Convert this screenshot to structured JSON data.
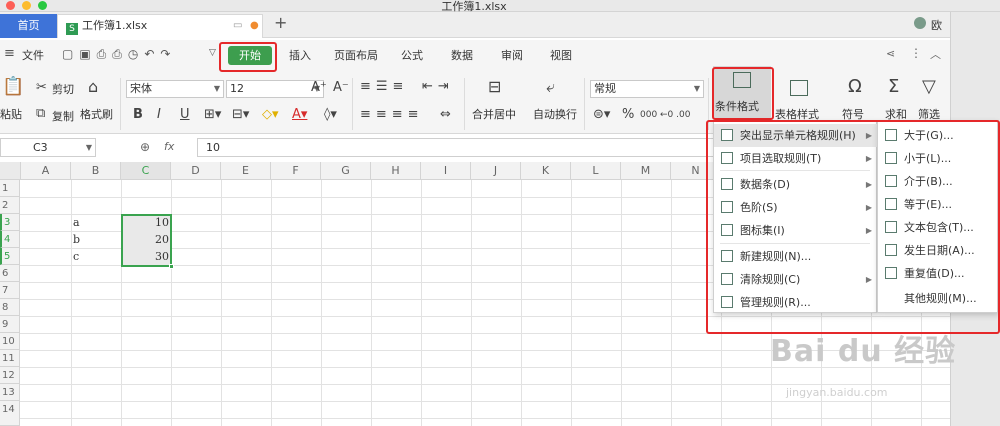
{
  "window": {
    "title": "工作簿1.xlsx"
  },
  "tabs": {
    "home": "首页",
    "file": "工作簿1.xlsx",
    "new_tab": "+",
    "user_short": "欧"
  },
  "menu": {
    "items": [
      "文件",
      "开始",
      "插入",
      "页面布局",
      "公式",
      "数据",
      "审阅",
      "视图"
    ]
  },
  "toolbar": {
    "paste": "粘贴",
    "cut": "剪切",
    "copy": "复制",
    "format_painter": "格式刷",
    "font_name": "宋体",
    "font_size": "12",
    "merge_center": "合并居中",
    "wrap_text": "自动换行",
    "number_format": "常规",
    "conditional_format": "条件格式",
    "table_style": "表格样式",
    "symbol": "符号",
    "sum": "求和",
    "filter": "筛选"
  },
  "formula_bar": {
    "cell_ref": "C3",
    "fx": "fx",
    "value": "10"
  },
  "grid": {
    "columns": [
      "A",
      "B",
      "C",
      "D",
      "E",
      "F",
      "G",
      "H",
      "I",
      "J",
      "K",
      "L",
      "M",
      "N"
    ],
    "rows": [
      "1",
      "2",
      "3",
      "4",
      "5",
      "6",
      "7",
      "8",
      "9",
      "10",
      "11",
      "12",
      "13",
      "14"
    ],
    "cells": [
      {
        "b": "a",
        "c": "10"
      },
      {
        "b": "b",
        "c": "20"
      },
      {
        "b": "c",
        "c": "30"
      }
    ]
  },
  "cond_menu": {
    "items": [
      {
        "label": "突出显示单元格规则(H)",
        "submenu": true,
        "icon": "highlight-rules-icon"
      },
      {
        "label": "项目选取规则(T)",
        "submenu": true,
        "icon": "top-bottom-rules-icon"
      },
      {
        "label": "数据条(D)",
        "submenu": true,
        "icon": "data-bars-icon"
      },
      {
        "label": "色阶(S)",
        "submenu": true,
        "icon": "color-scales-icon"
      },
      {
        "label": "图标集(I)",
        "submenu": true,
        "icon": "icon-sets-icon"
      },
      {
        "label": "新建规则(N)...",
        "submenu": false,
        "icon": "new-rule-icon"
      },
      {
        "label": "清除规则(C)",
        "submenu": true,
        "icon": "clear-rules-icon"
      },
      {
        "label": "管理规则(R)...",
        "submenu": false,
        "icon": "manage-rules-icon"
      }
    ]
  },
  "highlight_submenu": {
    "items": [
      "大于(G)...",
      "小于(L)...",
      "介于(B)...",
      "等于(E)...",
      "文本包含(T)...",
      "发生日期(A)...",
      "重复值(D)...",
      "其他规则(M)..."
    ]
  },
  "watermark": {
    "main": "Bai du 经验",
    "sub": "jingyan.baidu.com"
  },
  "colors": {
    "accent_green": "#3d9e4e",
    "tab_blue": "#3e73d8",
    "annotation_red": "#e5282a"
  }
}
